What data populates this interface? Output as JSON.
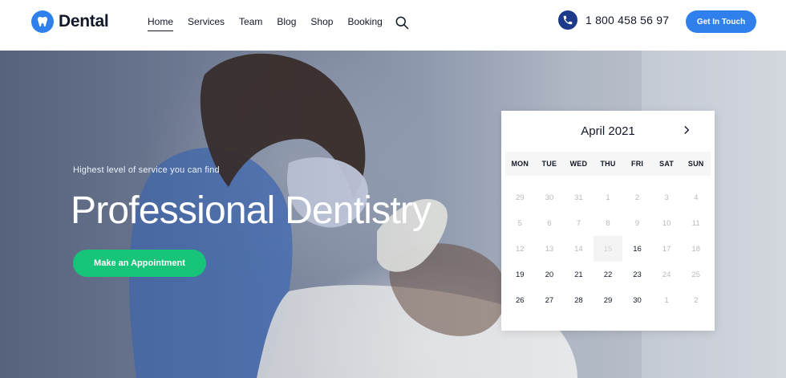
{
  "brand": {
    "name": "Dental",
    "accent": "#2f80ed"
  },
  "nav": {
    "items": [
      {
        "label": "Home",
        "active": true
      },
      {
        "label": "Services",
        "active": false
      },
      {
        "label": "Team",
        "active": false
      },
      {
        "label": "Blog",
        "active": false
      },
      {
        "label": "Shop",
        "active": false
      },
      {
        "label": "Booking",
        "active": false
      }
    ]
  },
  "header": {
    "search_icon": "search-icon",
    "phone_icon": "phone-icon",
    "phone": "1 800 458 56 97",
    "cta_label": "Get In Touch"
  },
  "hero": {
    "subtitle": "Highest level of service you can find",
    "title": "Professional Dentistry",
    "button_label": "Make an Appointment",
    "button_color": "#16c47a"
  },
  "calendar": {
    "title": "April 2021",
    "next_icon": "chevron-right-icon",
    "weekdays": [
      "MON",
      "TUE",
      "WED",
      "THU",
      "FRI",
      "SAT",
      "SUN"
    ],
    "days": [
      {
        "label": "29",
        "state": "muted"
      },
      {
        "label": "30",
        "state": "muted"
      },
      {
        "label": "31",
        "state": "muted"
      },
      {
        "label": "1",
        "state": "muted"
      },
      {
        "label": "2",
        "state": "muted"
      },
      {
        "label": "3",
        "state": "muted"
      },
      {
        "label": "4",
        "state": "muted"
      },
      {
        "label": "5",
        "state": "muted"
      },
      {
        "label": "6",
        "state": "muted"
      },
      {
        "label": "7",
        "state": "muted"
      },
      {
        "label": "8",
        "state": "muted"
      },
      {
        "label": "9",
        "state": "muted"
      },
      {
        "label": "10",
        "state": "muted"
      },
      {
        "label": "11",
        "state": "muted"
      },
      {
        "label": "12",
        "state": "muted"
      },
      {
        "label": "13",
        "state": "muted"
      },
      {
        "label": "14",
        "state": "muted"
      },
      {
        "label": "15",
        "state": "today"
      },
      {
        "label": "16",
        "state": "strong"
      },
      {
        "label": "17",
        "state": "muted"
      },
      {
        "label": "18",
        "state": "muted"
      },
      {
        "label": "19",
        "state": "strong"
      },
      {
        "label": "20",
        "state": "strong"
      },
      {
        "label": "21",
        "state": "strong"
      },
      {
        "label": "22",
        "state": "strong"
      },
      {
        "label": "23",
        "state": "strong"
      },
      {
        "label": "24",
        "state": "muted"
      },
      {
        "label": "25",
        "state": "muted"
      },
      {
        "label": "26",
        "state": "strong"
      },
      {
        "label": "27",
        "state": "strong"
      },
      {
        "label": "28",
        "state": "strong"
      },
      {
        "label": "29",
        "state": "strong"
      },
      {
        "label": "30",
        "state": "strong"
      },
      {
        "label": "1",
        "state": "muted"
      },
      {
        "label": "2",
        "state": "muted"
      }
    ]
  }
}
